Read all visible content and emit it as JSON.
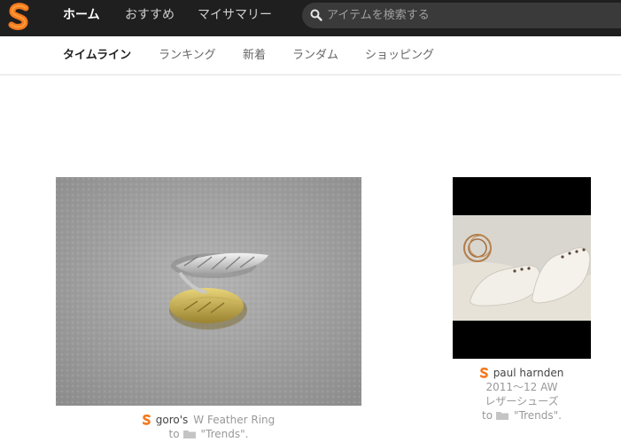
{
  "colors": {
    "accent": "#f47a1f",
    "topbar": "#1f1f1f"
  },
  "header": {
    "nav": [
      "ホーム",
      "おすすめ",
      "マイサマリー"
    ],
    "search": {
      "placeholder": "アイテムを検索する"
    }
  },
  "subnav": {
    "tabs": [
      "タイムライン",
      "ランキング",
      "新着",
      "ランダム",
      "ショッピング"
    ]
  },
  "cards": [
    {
      "image": "ring-photo",
      "user": "goro's",
      "title": "W Feather Ring",
      "to": "to",
      "folder": "\"Trends\"."
    },
    {
      "image": "shoes-photo",
      "user": "paul harnden",
      "line2": "2011〜12 AW",
      "line3": "レザーシューズ",
      "to": "to",
      "folder": "\"Trends\"."
    }
  ]
}
